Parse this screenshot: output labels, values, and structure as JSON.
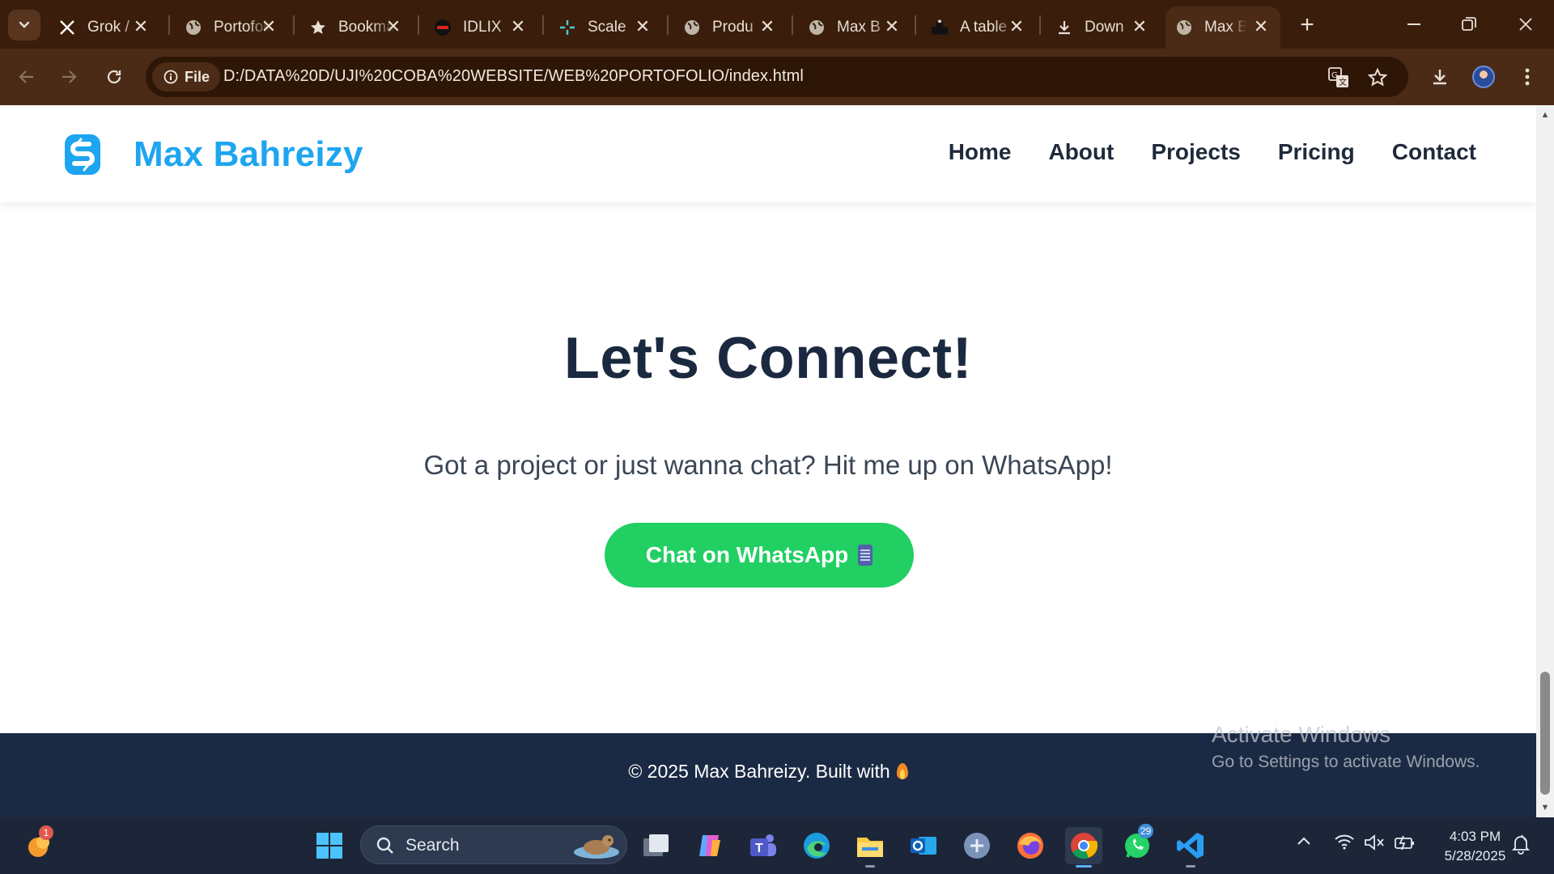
{
  "browser": {
    "tabs": [
      {
        "title": "Grok /",
        "icon": "x-logo-icon"
      },
      {
        "title": "Portofolio",
        "icon": "globe-icon"
      },
      {
        "title": "Bookmarks",
        "icon": "star-icon"
      },
      {
        "title": "IDLIX",
        "icon": "idlix-icon"
      },
      {
        "title": "Scale",
        "icon": "scale-icon"
      },
      {
        "title": "Produ",
        "icon": "globe-icon"
      },
      {
        "title": "Max B",
        "icon": "globe-icon"
      },
      {
        "title": "A table",
        "icon": "table-icon"
      },
      {
        "title": "Down",
        "icon": "download-icon"
      },
      {
        "title": "Max B",
        "icon": "globe-icon",
        "active": true
      }
    ],
    "site_info_label": "File",
    "url": "D:/DATA%20D/UJI%20COBA%20WEBSITE/WEB%20PORTOFOLIO/index.html"
  },
  "site": {
    "brand": "Max Bahreizy",
    "nav": [
      "Home",
      "About",
      "Projects",
      "Pricing",
      "Contact"
    ],
    "brand_color": "#1ea5f0"
  },
  "hero": {
    "title": "Let's Connect!",
    "subtitle": "Got a project or just wanna chat? Hit me up on WhatsApp!",
    "button_label": "Chat on WhatsApp",
    "button_color": "#22cf63"
  },
  "footer": {
    "text": "© 2025 Max Bahreizy. Built with",
    "background": "#1b2a44"
  },
  "watermark": {
    "line1": "Activate Windows",
    "line2": "Go to Settings to activate Windows."
  },
  "taskbar": {
    "search_label": "Search",
    "weather_badge": "1",
    "whatsapp_badge": "29",
    "time": "4:03 PM",
    "date": "5/28/2025"
  }
}
